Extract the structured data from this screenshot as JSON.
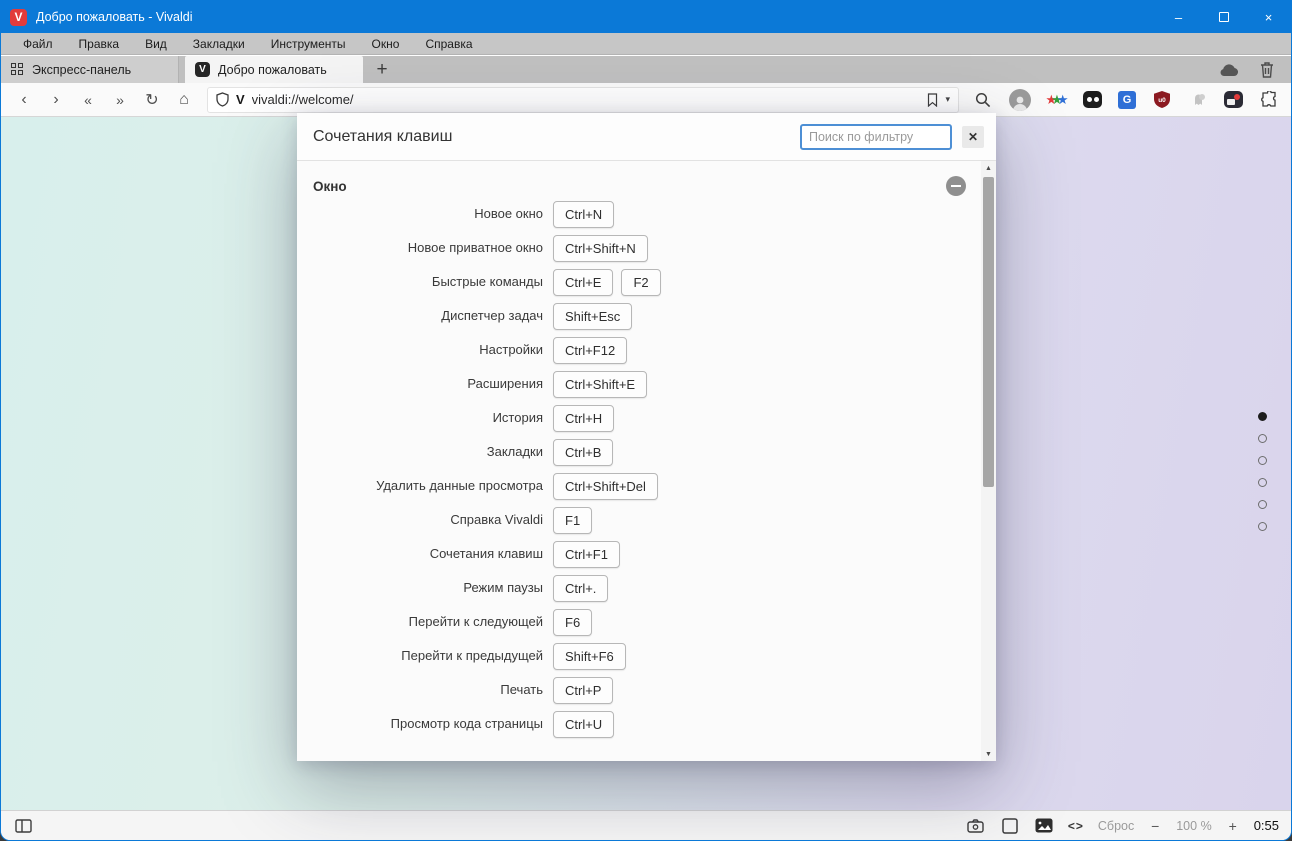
{
  "window": {
    "title": "Добро пожаловать - Vivaldi",
    "logo_letter": "V",
    "controls": {
      "minimize": "–",
      "close": "×"
    }
  },
  "menubar": {
    "items": [
      "Файл",
      "Правка",
      "Вид",
      "Закладки",
      "Инструменты",
      "Окно",
      "Справка"
    ]
  },
  "tabbar": {
    "speed_dial_label": "Экспресс-панель",
    "active_tab_label": "Добро пожаловать",
    "active_tab_favicon_letter": "V",
    "new_tab_label": "+"
  },
  "addressbar": {
    "back": "‹",
    "forward": "›",
    "rewind": "«",
    "fast_forward": "»",
    "reload": "↻",
    "home": "⌂",
    "url": "vivaldi://welcome/",
    "v_badge_letter": "V",
    "bookmark_caret": "▾",
    "translate_letter": "G"
  },
  "dialog": {
    "title": "Сочетания клавиш",
    "search_placeholder": "Поиск по фильтру",
    "close_glyph": "✕",
    "section_label": "Окно",
    "shortcuts": [
      {
        "label": "Новое окно",
        "keys": [
          "Ctrl+N"
        ]
      },
      {
        "label": "Новое приватное окно",
        "keys": [
          "Ctrl+Shift+N"
        ]
      },
      {
        "label": "Быстрые команды",
        "keys": [
          "Ctrl+E",
          "F2"
        ]
      },
      {
        "label": "Диспетчер задач",
        "keys": [
          "Shift+Esc"
        ]
      },
      {
        "label": "Настройки",
        "keys": [
          "Ctrl+F12"
        ]
      },
      {
        "label": "Расширения",
        "keys": [
          "Ctrl+Shift+E"
        ]
      },
      {
        "label": "История",
        "keys": [
          "Ctrl+H"
        ]
      },
      {
        "label": "Закладки",
        "keys": [
          "Ctrl+B"
        ]
      },
      {
        "label": "Удалить данные просмотра",
        "keys": [
          "Ctrl+Shift+Del"
        ]
      },
      {
        "label": "Справка Vivaldi",
        "keys": [
          "F1"
        ]
      },
      {
        "label": "Сочетания клавиш",
        "keys": [
          "Ctrl+F1"
        ]
      },
      {
        "label": "Режим паузы",
        "keys": [
          "Ctrl+."
        ]
      },
      {
        "label": "Перейти к следующей",
        "keys": [
          "F6"
        ]
      },
      {
        "label": "Перейти к предыдущей",
        "keys": [
          "Shift+F6"
        ]
      },
      {
        "label": "Печать",
        "keys": [
          "Ctrl+P"
        ]
      },
      {
        "label": "Просмотр кода страницы",
        "keys": [
          "Ctrl+U"
        ]
      }
    ],
    "scroll_up_glyph": "▲",
    "scroll_down_glyph": "▼"
  },
  "page_dots": {
    "count": 6,
    "active_index": 0
  },
  "statusbar": {
    "reset_label": "Сброс",
    "zoom_out": "−",
    "zoom_level": "100 %",
    "zoom_in": "+",
    "time": "0:55",
    "code_glyph": "<>"
  },
  "colors": {
    "titlebar_blue": "#0b79d7",
    "vivaldi_red": "#e23b3b",
    "focus_border_blue": "#4d8fd5",
    "page_gradient_left": "#d8efec",
    "page_gradient_right": "#d9d4ec"
  }
}
